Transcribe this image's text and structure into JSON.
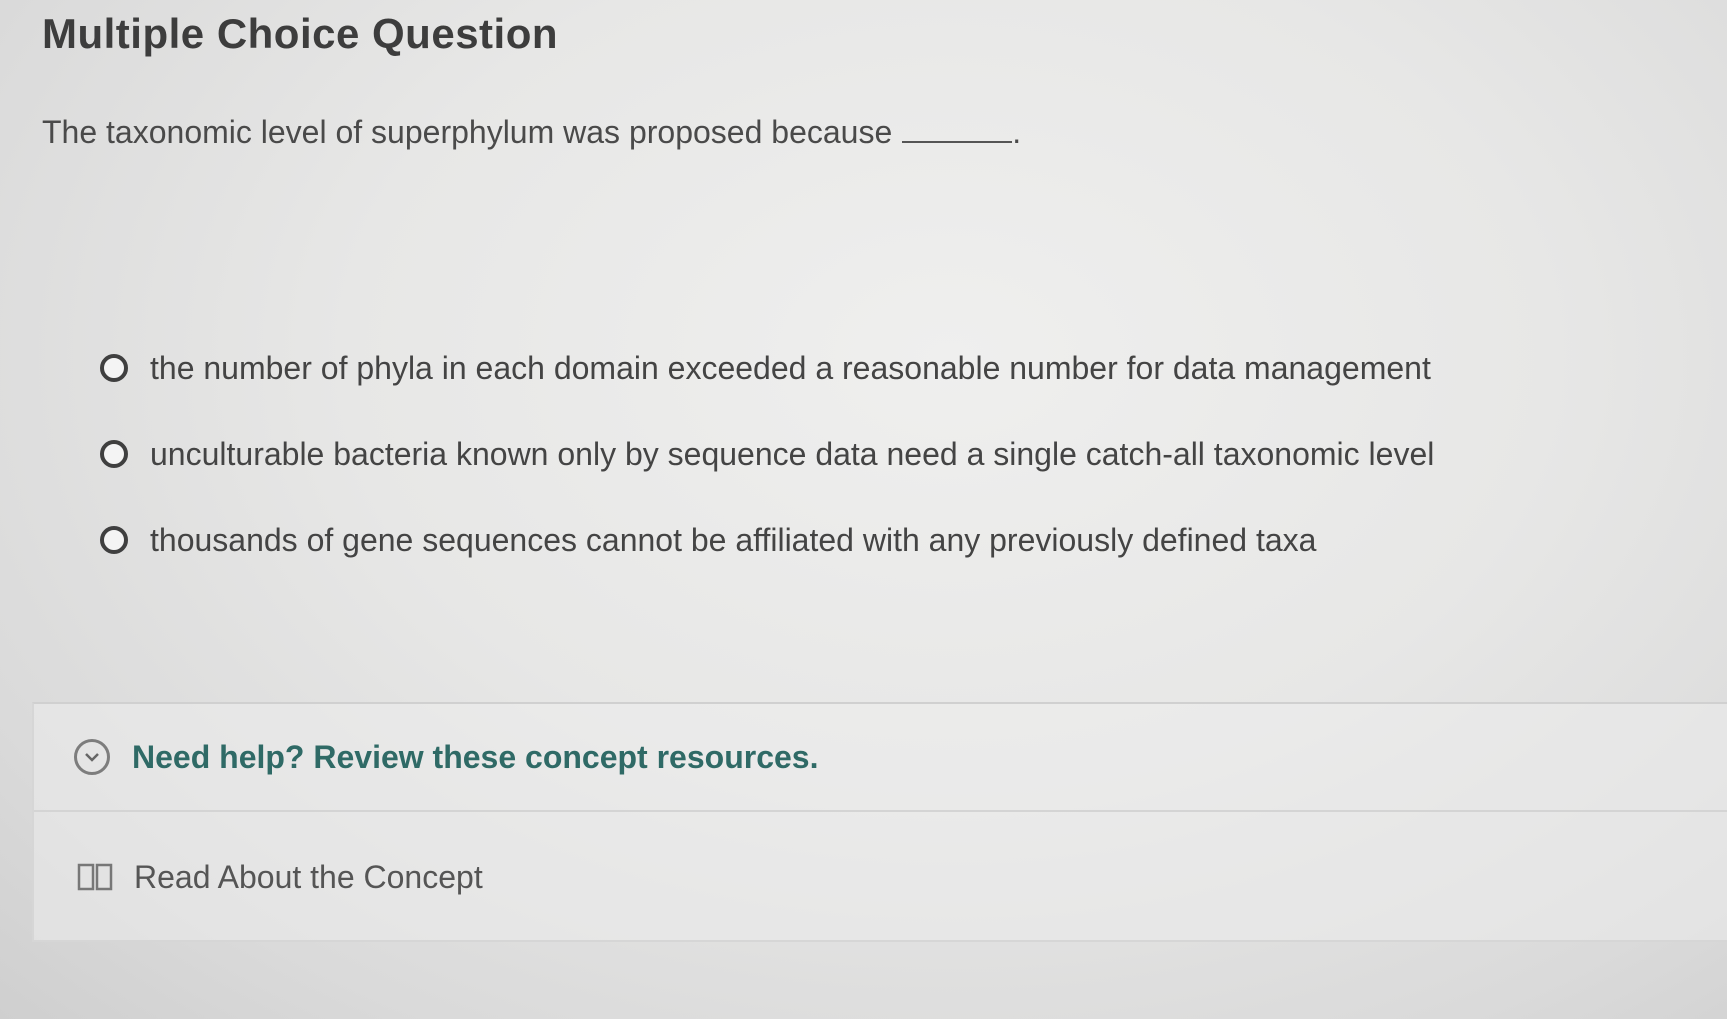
{
  "question": {
    "heading": "Multiple Choice Question",
    "prompt": "The taxonomic level of superphylum was proposed because",
    "prompt_end": "."
  },
  "choices": [
    {
      "label": "the number of phyla in each domain exceeded a reasonable number for data management"
    },
    {
      "label": "unculturable bacteria known only by sequence data need a single catch-all taxonomic level"
    },
    {
      "label": "thousands of gene sequences cannot be affiliated with any previously defined taxa"
    }
  ],
  "help": {
    "toggle_icon": "chevron-down-icon",
    "title": "Need help? Review these concept resources.",
    "resources": [
      {
        "icon": "book-icon",
        "label": "Read About the Concept"
      }
    ]
  },
  "colors": {
    "help_title": "#2f6a66",
    "background": "#e7e7e6"
  }
}
